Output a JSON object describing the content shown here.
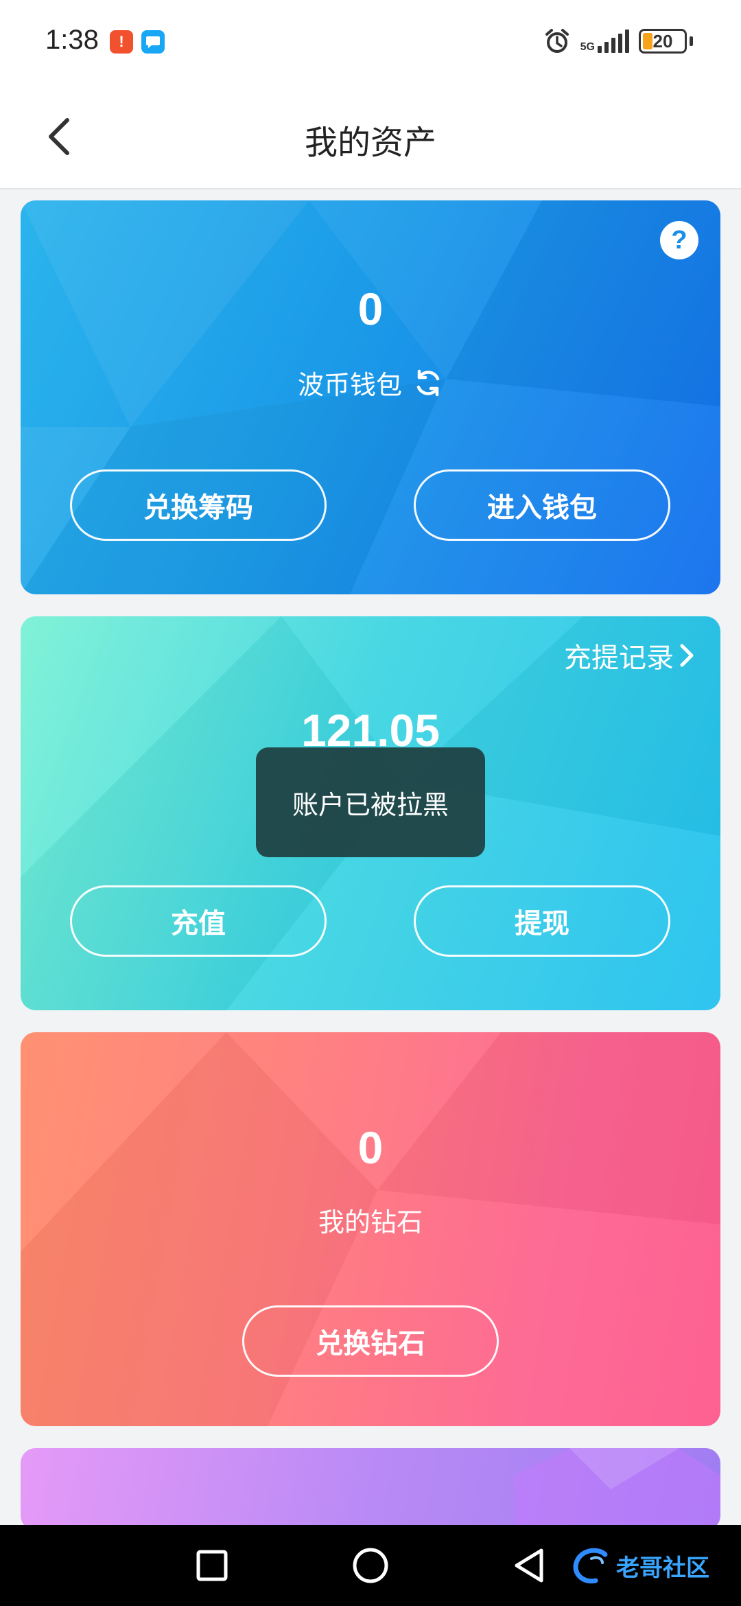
{
  "status_bar": {
    "time": "1:38",
    "network": "5G",
    "battery": "20",
    "app_icons": [
      "notification-app-icon",
      "message-app-icon"
    ]
  },
  "header": {
    "title": "我的资产"
  },
  "wallet_card": {
    "amount": "0",
    "label": "波币钱包",
    "exchange_button": "兑换筹码",
    "enter_button": "进入钱包"
  },
  "balance_card": {
    "records_link": "充提记录",
    "amount": "121.05",
    "deposit_button": "充值",
    "withdraw_button": "提现"
  },
  "diamond_card": {
    "amount": "0",
    "label": "我的钻石",
    "exchange_button": "兑换钻石"
  },
  "toast": {
    "message": "账户已被拉黑"
  },
  "watermark": {
    "text": "老哥社区"
  },
  "colors": {
    "wallet_gradient": [
      "#2bb4ec",
      "#1470ee"
    ],
    "balance_gradient": [
      "#77f1d4",
      "#24c1ef"
    ],
    "diamond_gradient": [
      "#ff8a6a",
      "#fd5b8e"
    ],
    "toast_bg": "#1e3e40"
  }
}
